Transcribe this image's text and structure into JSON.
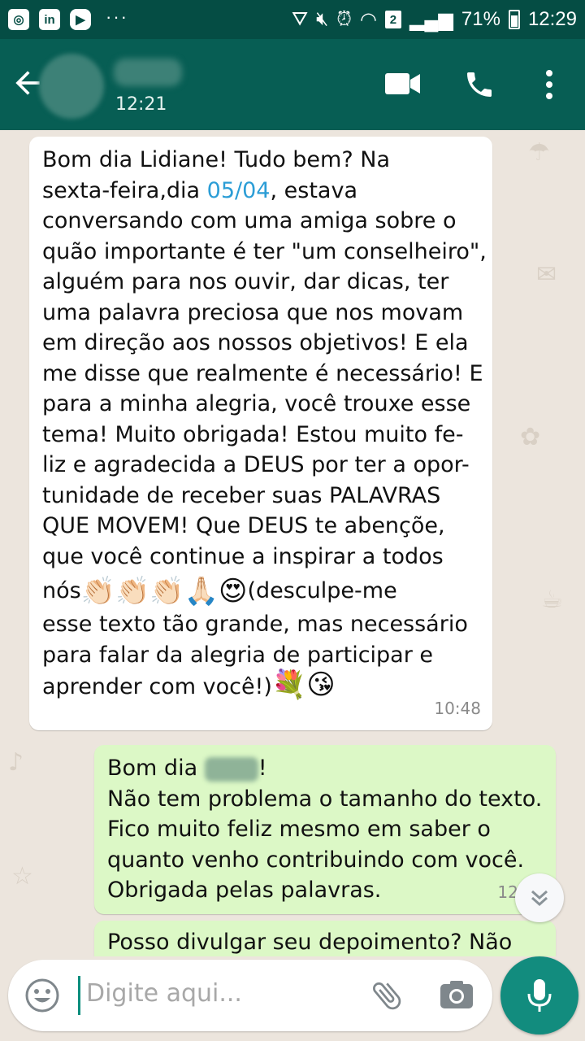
{
  "status_bar": {
    "app_icons": [
      "instagram-icon",
      "linkedin-icon",
      "youtube-icon"
    ],
    "more_indicator": "···",
    "sim_badge": "2",
    "battery": "71%",
    "time": "12:29"
  },
  "header": {
    "last_seen": "12:21",
    "icons": [
      "back-arrow-icon",
      "video-call-icon",
      "phone-icon",
      "more-vert-icon"
    ]
  },
  "messages": [
    {
      "direction": "incoming",
      "text_before_link": "Bom dia Lidiane! Tudo bem? Na\nsexta-feira,dia ",
      "link": "05/04",
      "text_after_link": ", estava\nconversando com uma amiga sobre o\nquão importante é ter \"um conselheiro\",\nalguém para nos ouvir, dar dicas, ter\numa palavra preciosa que nos movam\nem direção aos nossos objetivos! E ela\nme disse que realmente é necessário! E\npara a minha alegria, você trouxe esse\ntema! Muito obrigada! Estou muito fe-\nliz e agradecida a DEUS por ter a opor-\ntunidade de receber suas PALAVRAS\nQUE MOVEM! Que DEUS te abençõe,\nque você continue a inspirar a todos",
      "line_nos": "nós",
      "emojis_1": "👏🏻👏🏻👏🏻🙏🏻😍",
      "text_after_emoji": "(desculpe-me",
      "text_end": "esse texto tão grande, mas necessário\npara falar da alegria de participar e\naprender com você!)",
      "emojis_2": "💐😘",
      "time": "10:48"
    },
    {
      "direction": "outgoing",
      "greeting": "Bom dia",
      "greeting_end": "!",
      "text": "Não tem problema o tamanho do texto.\nFico muito feliz mesmo em saber o\nquanto venho contribuindo com você.\nObrigada pelas palavras.",
      "time": "12:00"
    },
    {
      "direction": "outgoing",
      "text": "Posso divulgar seu depoimento? Não"
    }
  ],
  "composer": {
    "placeholder": "Digite aqui...",
    "icons": [
      "emoji-icon",
      "attach-icon",
      "camera-icon",
      "mic-icon"
    ]
  },
  "colors": {
    "status_bar": "#054d44",
    "header": "#075e54",
    "chat_background": "#ece5dd",
    "incoming_bubble": "#ffffff",
    "outgoing_bubble": "#dcf8c6",
    "accent": "#128c7e",
    "link": "#2b9dd6"
  }
}
